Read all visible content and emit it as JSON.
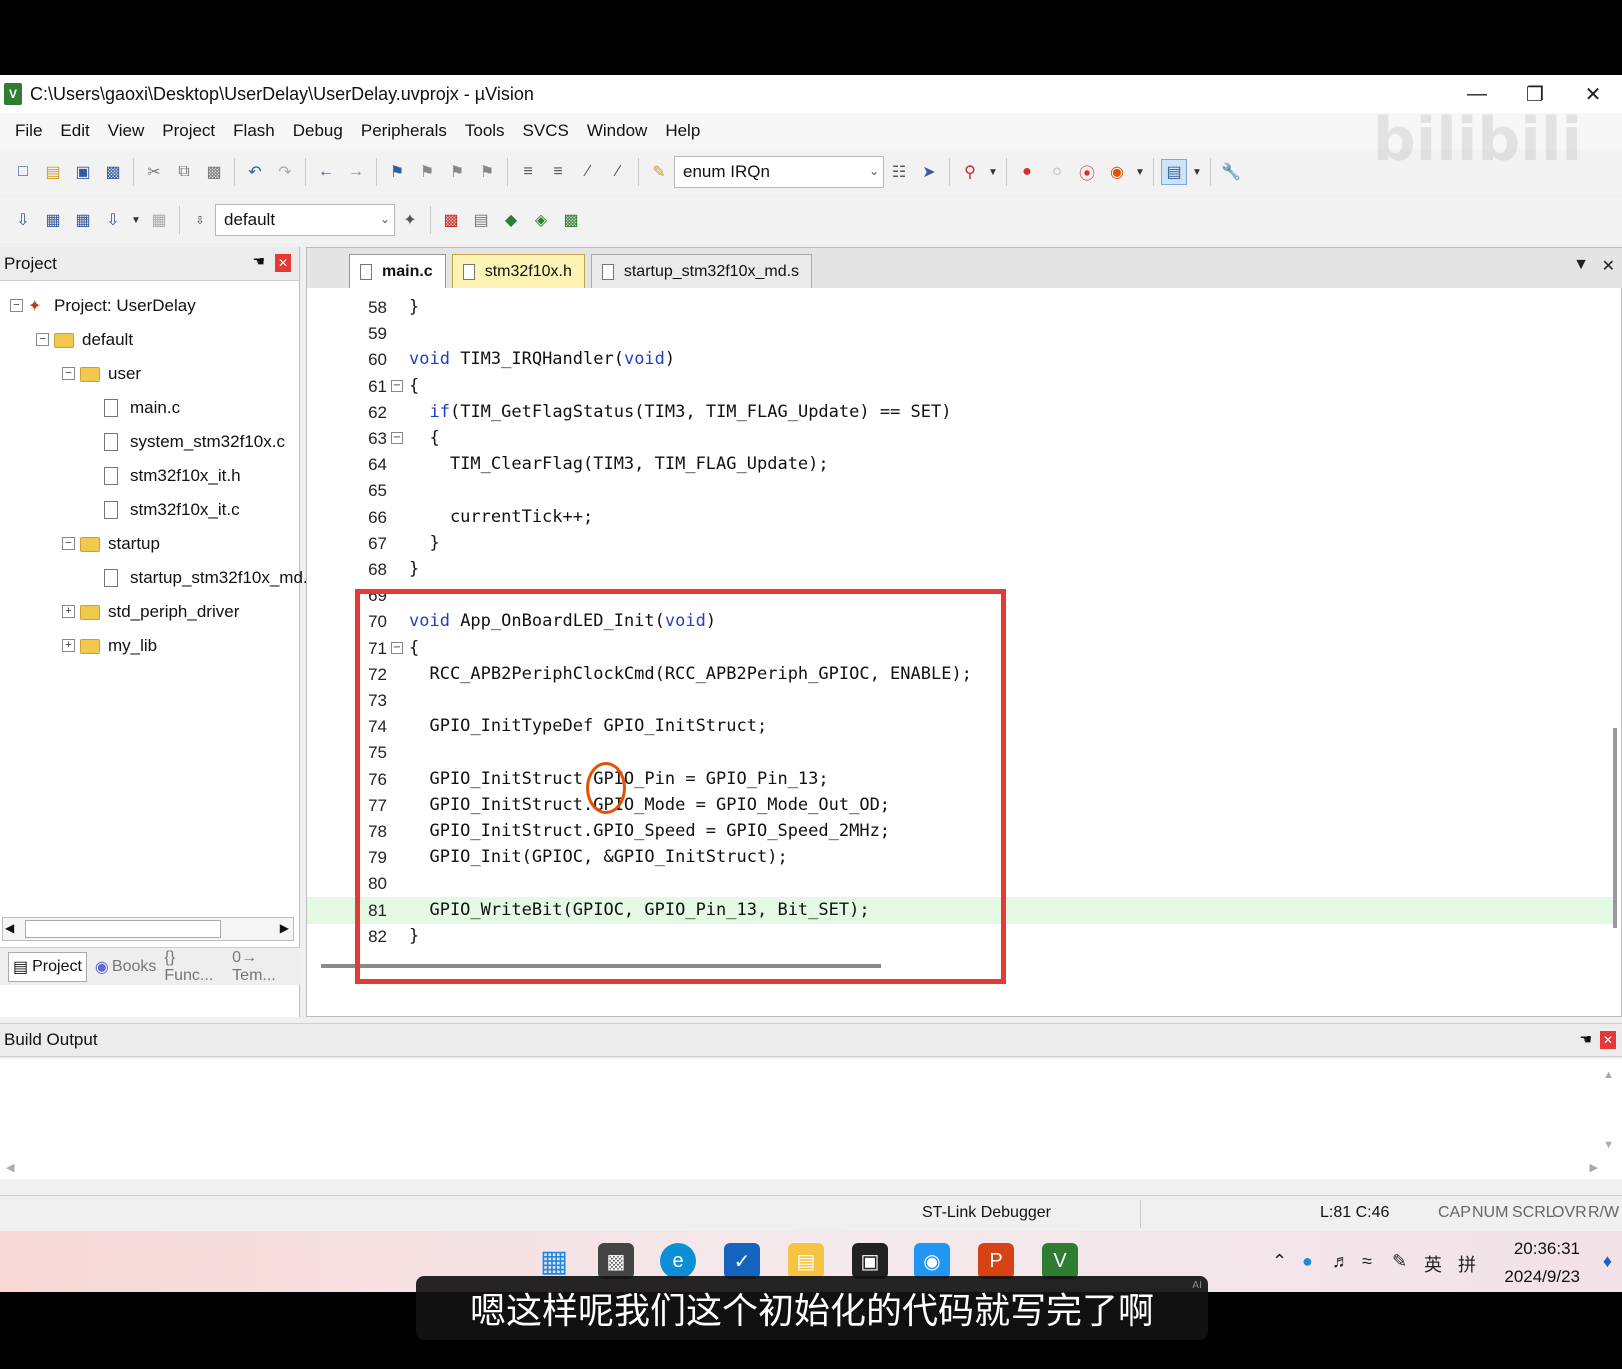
{
  "window": {
    "title": "C:\\Users\\gaoxi\\Desktop\\UserDelay\\UserDelay.uvprojx - µVision",
    "logo": "V"
  },
  "menu": [
    "File",
    "Edit",
    "View",
    "Project",
    "Flash",
    "Debug",
    "Peripherals",
    "Tools",
    "SVCS",
    "Window",
    "Help"
  ],
  "toolbar1": {
    "combo_value": "enum IRQn"
  },
  "toolbar2": {
    "target_value": "default"
  },
  "watermark": "bilibili",
  "project_panel": {
    "title": "Project",
    "tree": [
      {
        "label": "Project: UserDelay",
        "type": "project",
        "level": 0,
        "expander": "−"
      },
      {
        "label": "default",
        "type": "folder",
        "level": 1,
        "expander": "−"
      },
      {
        "label": "user",
        "type": "folder",
        "level": 2,
        "expander": "−"
      },
      {
        "label": "main.c",
        "type": "file",
        "level": 3
      },
      {
        "label": "system_stm32f10x.c",
        "type": "file",
        "level": 3
      },
      {
        "label": "stm32f10x_it.h",
        "type": "file",
        "level": 3
      },
      {
        "label": "stm32f10x_it.c",
        "type": "file",
        "level": 3
      },
      {
        "label": "startup",
        "type": "folder",
        "level": 2,
        "expander": "−"
      },
      {
        "label": "startup_stm32f10x_md.s",
        "type": "file",
        "level": 3
      },
      {
        "label": "std_periph_driver",
        "type": "folder",
        "level": 2,
        "expander": "+"
      },
      {
        "label": "my_lib",
        "type": "folder",
        "level": 2,
        "expander": "+"
      }
    ],
    "tabs": [
      "Project",
      "Books",
      "{} Func...",
      "0→ Tem..."
    ]
  },
  "editor": {
    "tabs": [
      {
        "label": "main.c",
        "active": true
      },
      {
        "label": "stm32f10x.h",
        "active": false
      },
      {
        "label": "startup_stm32f10x_md.s",
        "active": false
      }
    ],
    "lines": [
      {
        "n": "58",
        "text": "}",
        "fold": ""
      },
      {
        "n": "59",
        "text": "",
        "fold": ""
      },
      {
        "n": "60",
        "text": "void TIM3_IRQHandler(void)",
        "fold": ""
      },
      {
        "n": "61",
        "text": "{",
        "fold": "−"
      },
      {
        "n": "62",
        "text": "  if(TIM_GetFlagStatus(TIM3, TIM_FLAG_Update) == SET)",
        "fold": ""
      },
      {
        "n": "63",
        "text": "  {",
        "fold": "−"
      },
      {
        "n": "64",
        "text": "    TIM_ClearFlag(TIM3, TIM_FLAG_Update);",
        "fold": ""
      },
      {
        "n": "65",
        "text": "",
        "fold": ""
      },
      {
        "n": "66",
        "text": "    currentTick++;",
        "fold": ""
      },
      {
        "n": "67",
        "text": "  }",
        "fold": ""
      },
      {
        "n": "68",
        "text": "}",
        "fold": ""
      },
      {
        "n": "69",
        "text": "",
        "fold": ""
      },
      {
        "n": "70",
        "text": "void App_OnBoardLED_Init(void)",
        "fold": ""
      },
      {
        "n": "71",
        "text": "{",
        "fold": "−"
      },
      {
        "n": "72",
        "text": "  RCC_APB2PeriphClockCmd(RCC_APB2Periph_GPIOC, ENABLE);",
        "fold": ""
      },
      {
        "n": "73",
        "text": "",
        "fold": ""
      },
      {
        "n": "74",
        "text": "  GPIO_InitTypeDef GPIO_InitStruct;",
        "fold": ""
      },
      {
        "n": "75",
        "text": "",
        "fold": ""
      },
      {
        "n": "76",
        "text": "  GPIO_InitStruct.GPIO_Pin = GPIO_Pin_13;",
        "fold": ""
      },
      {
        "n": "77",
        "text": "  GPIO_InitStruct.GPIO_Mode = GPIO_Mode_Out_OD;",
        "fold": ""
      },
      {
        "n": "78",
        "text": "  GPIO_InitStruct.GPIO_Speed = GPIO_Speed_2MHz;",
        "fold": ""
      },
      {
        "n": "79",
        "text": "  GPIO_Init(GPIOC, &GPIO_InitStruct);",
        "fold": ""
      },
      {
        "n": "80",
        "text": "",
        "fold": ""
      },
      {
        "n": "81",
        "text": "  GPIO_WriteBit(GPIOC, GPIO_Pin_13, Bit_SET);",
        "fold": "",
        "current": true
      },
      {
        "n": "82",
        "text": "}",
        "fold": ""
      }
    ]
  },
  "build_output": {
    "title": "Build Output"
  },
  "statusbar": {
    "debugger": "ST-Link Debugger",
    "position": "L:81 C:46",
    "flags": [
      "CAP",
      "NUM",
      "SCRL",
      "OVR",
      "R/W"
    ]
  },
  "taskbar": {
    "tray_ime": "英",
    "tray_pinyin": "拼",
    "time": "20:36:31",
    "date": "2024/9/23"
  },
  "subtitle": {
    "text": "嗯这样呢我们这个初始化的代码就写完了啊",
    "badge": "AI"
  },
  "colors": {
    "keyword": "#1f3fbf",
    "highlight_box": "#e53935",
    "current_line": "#e4f9e4"
  }
}
